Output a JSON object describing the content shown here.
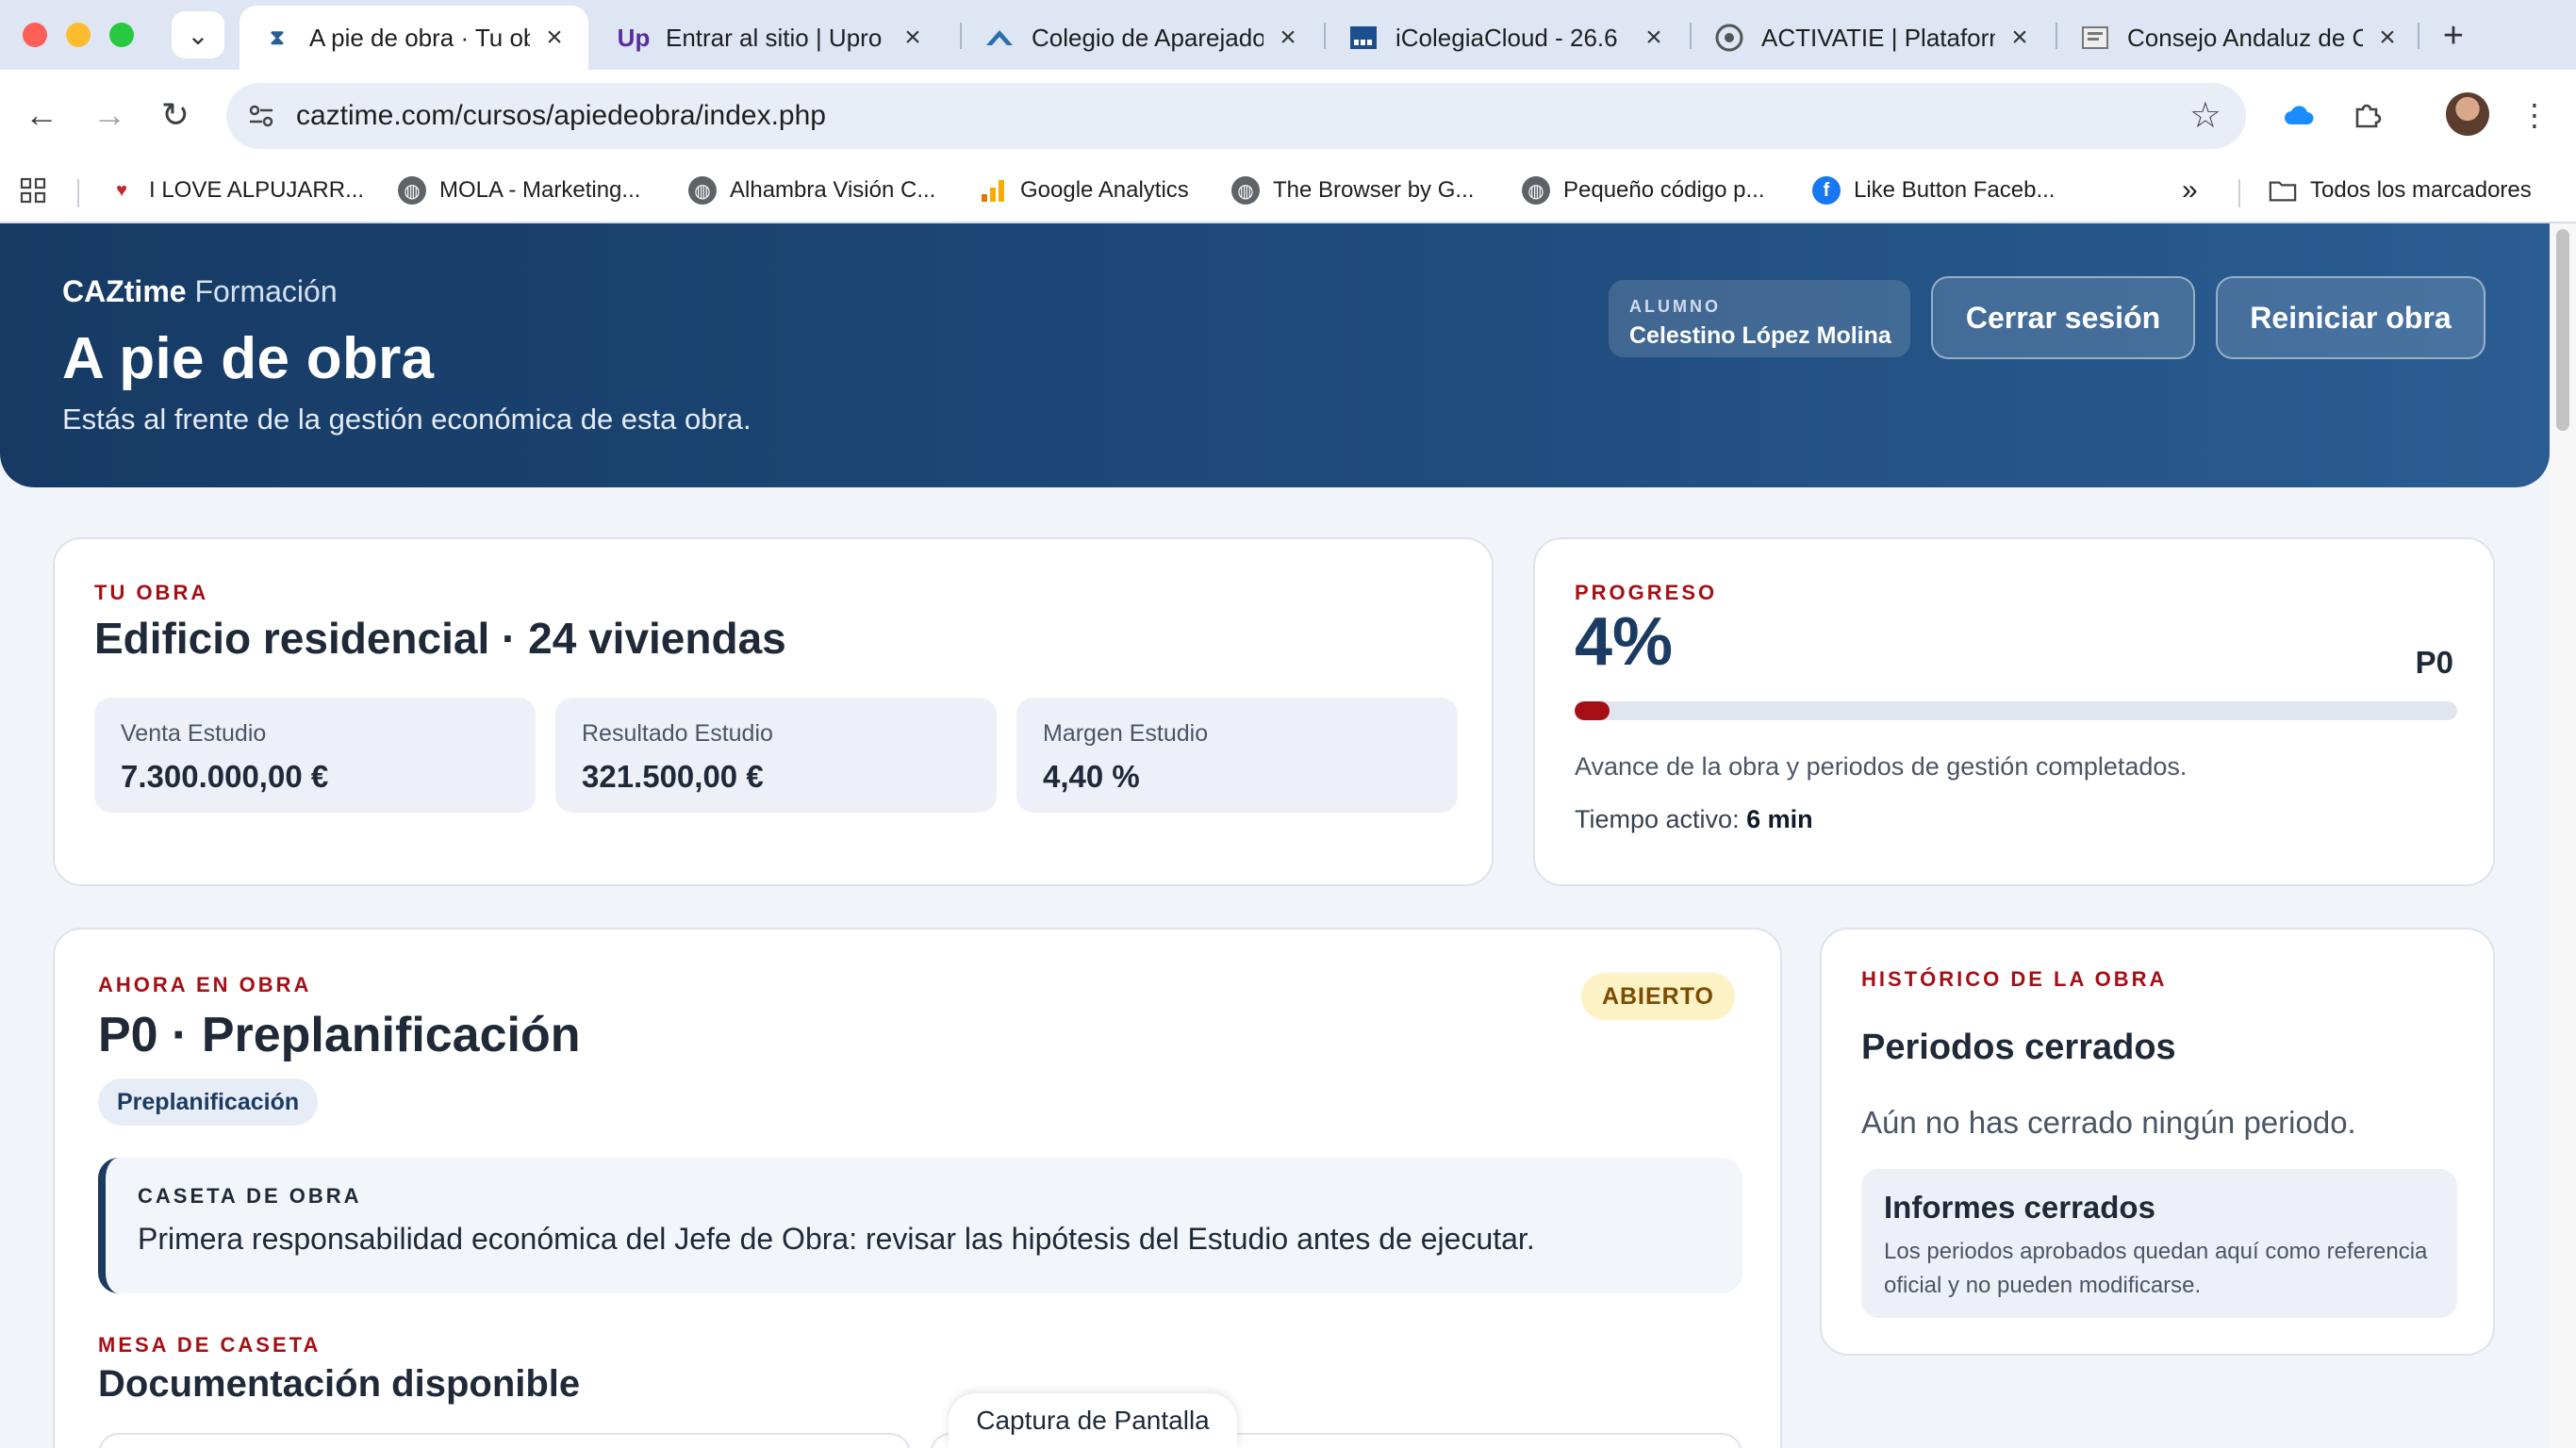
{
  "browser": {
    "tabs": [
      {
        "title": "A pie de obra · Tu obra",
        "icon": "caztime-favicon",
        "active": true
      },
      {
        "title": "Entrar al sitio | Upro",
        "icon": "upro-favicon"
      },
      {
        "title": "Colegio de Aparejadores",
        "icon": "colegio-favicon"
      },
      {
        "title": "iColegiaCloud - 26.6",
        "icon": "icolegia-favicon"
      },
      {
        "title": "ACTIVATIE | Plataforma",
        "icon": "activatie-favicon"
      },
      {
        "title": "Consejo Andaluz de Colegios",
        "icon": "consejo-favicon"
      }
    ],
    "url": "caztime.com/cursos/apiedeobra/index.php",
    "bookmarks": [
      {
        "label": "I LOVE ALPUJARR...",
        "color": "#c62828"
      },
      {
        "label": "MOLA - Marketing...",
        "color": "#5f6368"
      },
      {
        "label": "Alhambra Visión C...",
        "color": "#5f6368"
      },
      {
        "label": "Google Analytics",
        "color": "#f9ab00"
      },
      {
        "label": "The Browser by G...",
        "color": "#5f6368"
      },
      {
        "label": "Pequeño código p...",
        "color": "#5f6368"
      },
      {
        "label": "Like Button Faceb...",
        "color": "#1877f2"
      }
    ],
    "bookmarks_overflow": "»",
    "all_bookmarks": "Todos los marcadores"
  },
  "header": {
    "brand_bold": "CAZtime",
    "brand_light": "Formación",
    "title": "A pie de obra",
    "subtitle": "Estás al frente de la gestión económica de esta obra.",
    "student_label": "ALUMNO",
    "student_name": "Celestino López Molina",
    "logout_label": "Cerrar sesión",
    "reset_label": "Reiniciar obra"
  },
  "obra": {
    "kicker": "TU OBRA",
    "title": "Edificio residencial · 24 viviendas",
    "stats": [
      {
        "label": "Venta Estudio",
        "value": "7.300.000,00 €"
      },
      {
        "label": "Resultado Estudio",
        "value": "321.500,00 €"
      },
      {
        "label": "Margen Estudio",
        "value": "4,40 %"
      }
    ]
  },
  "progress": {
    "kicker": "PROGRESO",
    "percent_label": "4%",
    "percent": 4,
    "period": "P0",
    "description": "Avance de la obra y periodos de gestión completados.",
    "time_label": "Tiempo activo:",
    "time_value": "6 min",
    "bar_color": "#a50f15"
  },
  "current": {
    "kicker": "AHORA EN OBRA",
    "title": "P0 · Preplanificación",
    "status": "ABIERTO",
    "chip": "Preplanificación",
    "note_kicker": "CASETA DE OBRA",
    "note_text": "Primera responsabilidad económica del Jefe de Obra: revisar las hipótesis del Estudio antes de ejecutar.",
    "docs_kicker": "MESA DE CASETA",
    "docs_title": "Documentación disponible"
  },
  "history": {
    "kicker": "HISTÓRICO DE LA OBRA",
    "title": "Periodos cerrados",
    "empty": "Aún no has cerrado ningún periodo.",
    "box_title": "Informes cerrados",
    "box_text": "Los periodos aprobados quedan aquí como referencia oficial y no pueden modificarse."
  },
  "overlay": {
    "capture_label": "Captura de Pantalla"
  },
  "colors": {
    "brand_navy": "#1b3b63",
    "accent_red": "#a50f15",
    "badge_bg": "#fdf1c6"
  }
}
